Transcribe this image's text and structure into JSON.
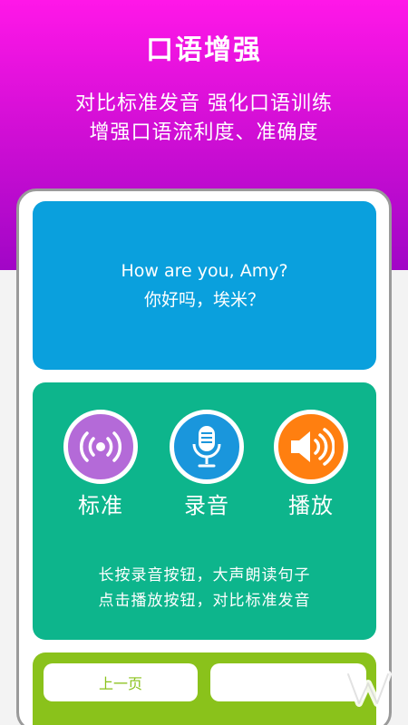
{
  "header": {
    "title": "口语增强",
    "subtitle_line1": "对比标准发音 强化口语训练",
    "subtitle_line2": "增强口语流利度、准确度"
  },
  "sentence": {
    "english": "How are you, Amy?",
    "chinese": "你好吗，埃米？"
  },
  "controls": {
    "standard_label": "标准",
    "record_label": "录音",
    "play_label": "播放"
  },
  "hints": {
    "line1": "长按录音按钮，大声朗读句子",
    "line2": "点击播放按钮，对比标准发音"
  },
  "nav": {
    "prev_label": "上一页",
    "next_label": ""
  },
  "colors": {
    "header_gradient_top": "#ff17e8",
    "header_gradient_bottom": "#a106c6",
    "sentence_card": "#0aa0dd",
    "control_card": "#0db58c",
    "nav_card": "#8ac21b",
    "standard_button": "#b46ad8",
    "record_button": "#1a96dc",
    "play_button": "#ff7f10"
  },
  "icons": {
    "standard": "broadcast-icon",
    "record": "microphone-icon",
    "play": "speaker-icon"
  }
}
